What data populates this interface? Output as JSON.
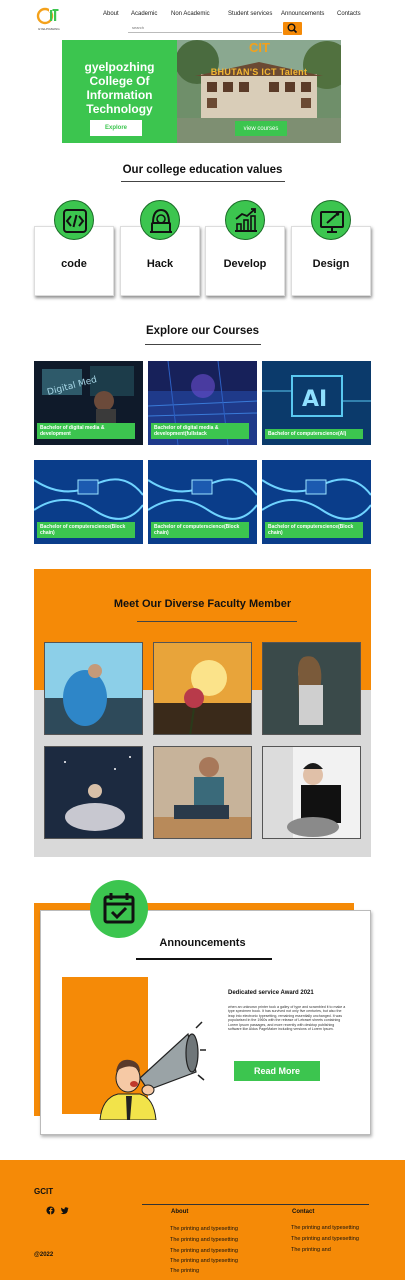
{
  "header": {
    "logo_text": "GYELPOZHING",
    "nav": [
      "About",
      "Academic",
      "Non Academic",
      "Student services",
      "Announcements",
      "Contacts"
    ],
    "search_placeholder": "search"
  },
  "hero": {
    "title_lines": [
      "gyelpozhing",
      "College Of",
      "Information",
      "Technology"
    ],
    "explore_label": "Explore",
    "image_logo": "CIT",
    "image_tagline": "BHUTAN'S ICT Talent",
    "view_courses_label": "view courses"
  },
  "values": {
    "title": "Our college education values",
    "cards": [
      {
        "label": "code",
        "icon": "code-icon"
      },
      {
        "label": "Hack",
        "icon": "hacker-icon"
      },
      {
        "label": "Develop",
        "icon": "growth-chart-icon"
      },
      {
        "label": "Design",
        "icon": "design-monitor-icon"
      }
    ]
  },
  "courses": {
    "title": "Explore our Courses",
    "items": [
      {
        "label": "Bachelor of digital media & development"
      },
      {
        "label": "Bachelor of digital media & development(fullstack"
      },
      {
        "label": "Bachelor of computerscience(AI)"
      },
      {
        "label": "Bachelor of computerscience(Block chain)"
      },
      {
        "label": "Bachelor of computerscience(Block chain)"
      },
      {
        "label": "Bachelor of computerscience(Block chain)"
      }
    ]
  },
  "faculty": {
    "title": "Meet Our Diverse Faculty Member"
  },
  "announcements": {
    "title": "Announcements",
    "item_heading": "Dedicated service Award 2021",
    "item_body": "when an unknown printer took a galley of type and scrambled it to make a type specimen book. It has survived not only five centuries, but also the leap into electronic typesetting, remaining essentially unchanged. It was popularised in the 1960s with the release of Letraset sheets containing Lorem Ipsum passages, and more recently with desktop publishing software like Aldus PageMaker including versions of Lorem Ipsum.",
    "read_more_label": "Read More"
  },
  "footer": {
    "brand": "GCIT",
    "copyright": "@2022",
    "about_heading": "About",
    "about_links": [
      "The printing and typesetting",
      "The printing and typesetting",
      "The printing and typesetting",
      "The printing and typesetting",
      "The printing"
    ],
    "contact_heading": "Contact",
    "contact_links": [
      "The printing and typesetting",
      "The printing and typesetting",
      "The printing and"
    ]
  },
  "colors": {
    "accent_orange": "#f58a07",
    "accent_green": "#3cc54f",
    "gray_band": "#d9d9d9"
  }
}
